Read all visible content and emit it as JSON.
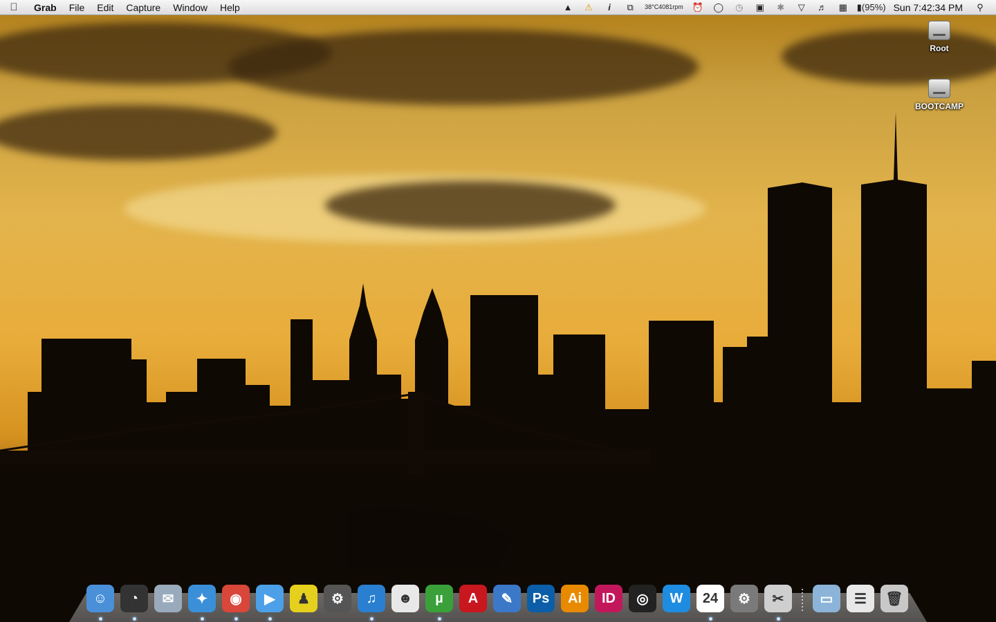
{
  "menubar": {
    "app_name": "Grab",
    "items": [
      "File",
      "Edit",
      "Capture",
      "Window",
      "Help"
    ],
    "status": {
      "temp_line1": "38°C",
      "temp_line2": "4081rpm",
      "battery": "(95%)",
      "clock": "Sun 7:42:34 PM"
    }
  },
  "desktop": {
    "icons": [
      {
        "label": "Root"
      },
      {
        "label": "BOOTCAMP"
      }
    ]
  },
  "dock": {
    "apps": [
      {
        "name": "finder-icon",
        "glyph": "☺",
        "color": "#4a90d9"
      },
      {
        "name": "dashboard-icon",
        "glyph": "◔",
        "color": "#333333"
      },
      {
        "name": "mail-icon",
        "glyph": "✉",
        "color": "#9aaabd"
      },
      {
        "name": "safari-icon",
        "glyph": "✦",
        "color": "#3a8fd8"
      },
      {
        "name": "chrome-icon",
        "glyph": "◉",
        "color": "#d9463a"
      },
      {
        "name": "ichat-icon",
        "glyph": "▶",
        "color": "#4ba0e8"
      },
      {
        "name": "adium-icon",
        "glyph": "♟",
        "color": "#e6d01e"
      },
      {
        "name": "steam-icon",
        "glyph": "⚙",
        "color": "#555555"
      },
      {
        "name": "itunes-icon",
        "glyph": "♫",
        "color": "#2a7fd0"
      },
      {
        "name": "cyberduck-icon",
        "glyph": "☻",
        "color": "#e8e8e8"
      },
      {
        "name": "utorrent-icon",
        "glyph": "µ",
        "color": "#3aa03a"
      },
      {
        "name": "acrobat-icon",
        "glyph": "A",
        "color": "#c8171e"
      },
      {
        "name": "xcode-icon",
        "glyph": "✎",
        "color": "#3c78c8"
      },
      {
        "name": "photoshop-icon",
        "glyph": "Ps",
        "color": "#0c5ea8"
      },
      {
        "name": "illustrator-icon",
        "glyph": "Ai",
        "color": "#e88a00"
      },
      {
        "name": "indesign-icon",
        "glyph": "ID",
        "color": "#c2185b"
      },
      {
        "name": "aperture-icon",
        "glyph": "◎",
        "color": "#222222"
      },
      {
        "name": "word-icon",
        "glyph": "W",
        "color": "#1e8ce0"
      },
      {
        "name": "ical-icon",
        "glyph": "24",
        "color": "#ffffff"
      },
      {
        "name": "system-preferences-icon",
        "glyph": "⚙",
        "color": "#7a7a7a"
      },
      {
        "name": "grab-icon",
        "glyph": "✂",
        "color": "#cfcfcf"
      }
    ],
    "others": [
      {
        "name": "applications-folder-icon",
        "glyph": "▭",
        "color": "#8cb4d8"
      },
      {
        "name": "downloads-stack-icon",
        "glyph": "☰",
        "color": "#e8e8e8"
      },
      {
        "name": "trash-icon",
        "glyph": "🗑",
        "color": "#c8c8c8"
      }
    ]
  }
}
